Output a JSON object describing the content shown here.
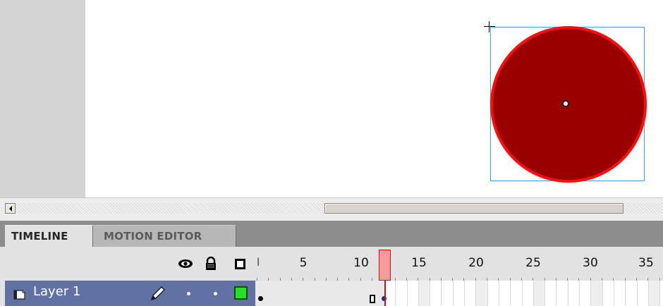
{
  "panel_tabs": [
    {
      "label": "TIMELINE",
      "active": true
    },
    {
      "label": "MOTION EDITOR",
      "active": false
    }
  ],
  "timeline": {
    "header_icons": [
      "eye-icon",
      "lock-icon",
      "outline-icon"
    ],
    "ruler_labels": [
      "l",
      "5",
      "10",
      "15",
      "20",
      "25",
      "30",
      "35"
    ],
    "current_frame": 12,
    "layers": [
      {
        "name": "Layer 1",
        "color": "#25e025",
        "selected": true,
        "editable_icon": "pencil-icon"
      }
    ]
  },
  "stage": {
    "shape": {
      "fill_color": "#990000",
      "stroke_color": "#ff0d0d",
      "selection_color": "#36a8e8"
    }
  },
  "colors": {
    "layer_row_selected": "#6271a4",
    "playhead": "#f79a9a",
    "tab_bar": "#8d8d8d"
  }
}
